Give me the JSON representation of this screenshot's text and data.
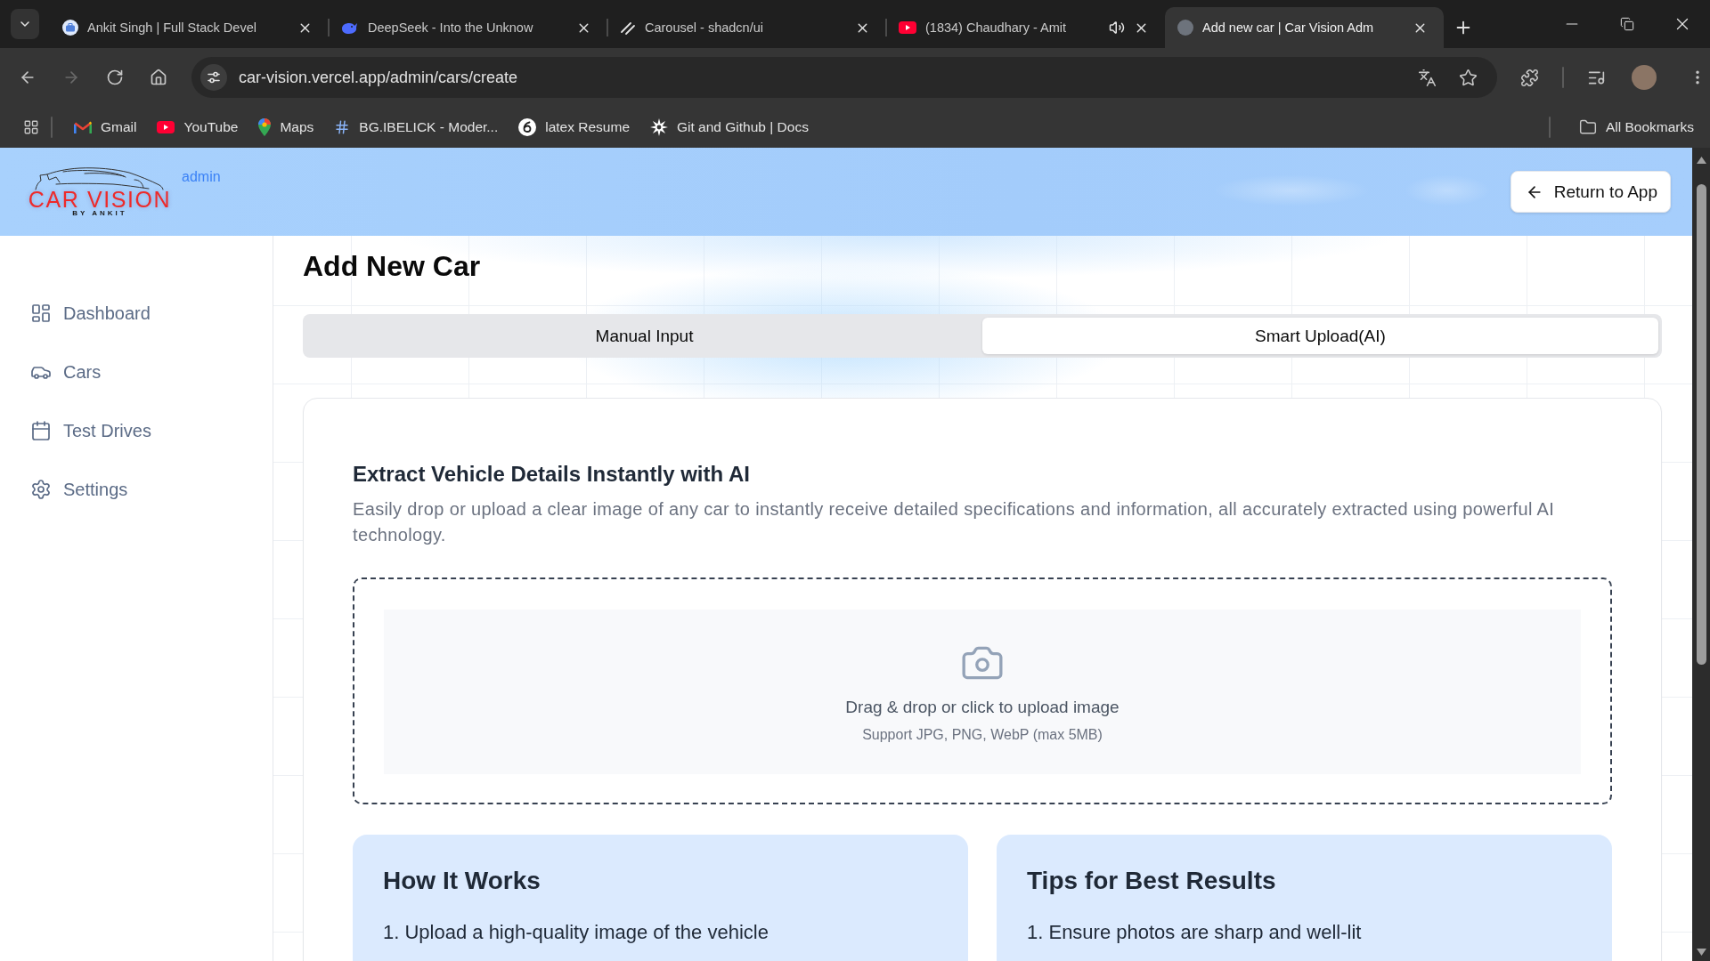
{
  "browser": {
    "tabs": [
      {
        "title": "Ankit Singh | Full Stack Devel",
        "selected": false,
        "audio": false
      },
      {
        "title": "DeepSeek - Into the Unknow",
        "selected": false,
        "audio": false
      },
      {
        "title": "Carousel - shadcn/ui",
        "selected": false,
        "audio": false
      },
      {
        "title": "(1834) Chaudhary - Amit",
        "selected": false,
        "audio": true
      },
      {
        "title": "Add new car | Car Vision Adm",
        "selected": true,
        "audio": false
      }
    ],
    "forward_disabled": true,
    "address": "car-vision.vercel.app/admin/cars/create",
    "bookmarks": [
      "Gmail",
      "YouTube",
      "Maps",
      "BG.IBELICK - Moder...",
      "latex Resume",
      "Git and Github | Docs"
    ],
    "all_bookmarks": "All Bookmarks"
  },
  "header": {
    "logo_title": "CAR VISION",
    "logo_subtitle": "BY ANKIT",
    "badge": "admin",
    "return_button": "Return to App"
  },
  "sidebar": {
    "items": [
      {
        "label": "Dashboard",
        "selected": false
      },
      {
        "label": "Cars",
        "selected": false
      },
      {
        "label": "Test Drives",
        "selected": false
      },
      {
        "label": "Settings",
        "selected": false
      }
    ]
  },
  "main": {
    "title": "Add New Car",
    "tabs": [
      {
        "label": "Manual Input",
        "selected": false
      },
      {
        "label": "Smart Upload(AI)",
        "selected": true
      }
    ],
    "panel": {
      "heading": "Extract Vehicle Details Instantly with AI",
      "description": "Easily drop or upload a clear image of any car to instantly receive detailed specifications and information, all accurately extracted using powerful AI technology.",
      "dropzone": {
        "prompt": "Drag & drop or click to upload image",
        "hint": "Support JPG, PNG, WebP (max 5MB)"
      },
      "info_cards": [
        {
          "title": "How It Works",
          "items": [
            "1. Upload a high-quality image of the vehicle"
          ]
        },
        {
          "title": "Tips for Best Results",
          "items": [
            "1. Ensure photos are sharp and well-lit"
          ]
        }
      ]
    }
  }
}
